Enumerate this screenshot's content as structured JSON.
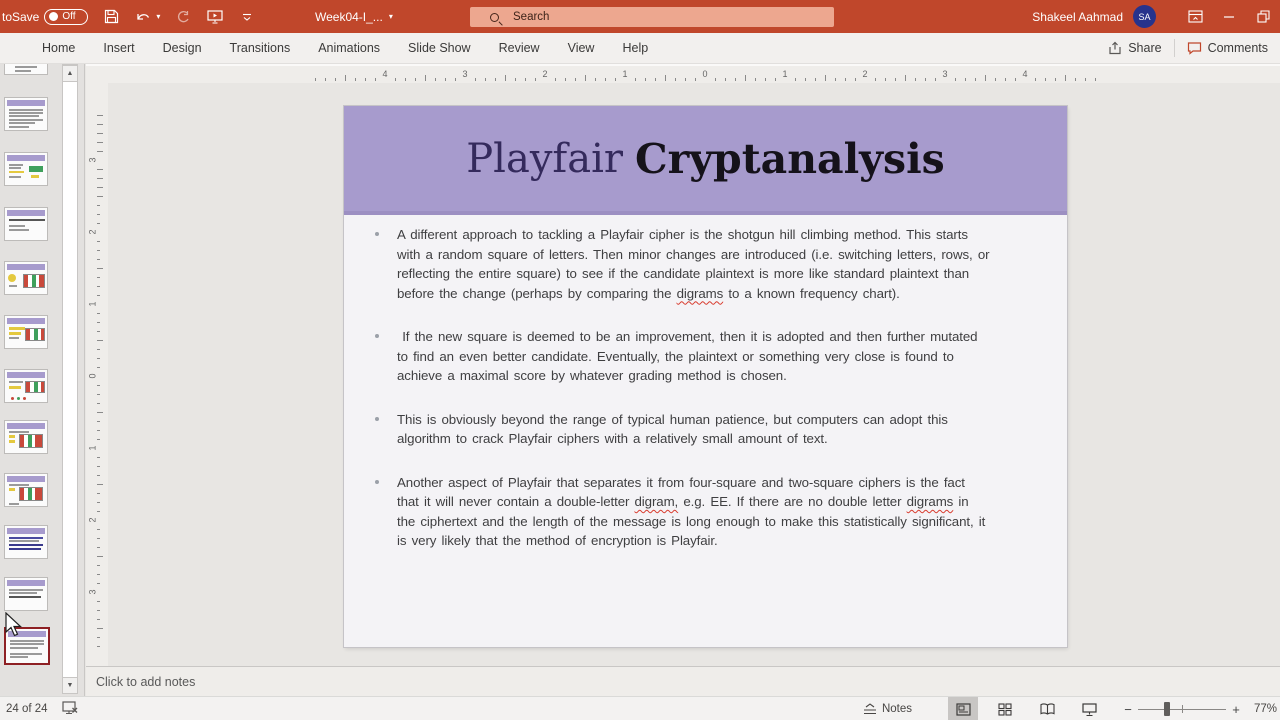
{
  "titlebar": {
    "autosave_label": "toSave",
    "autosave_state": "Off",
    "filename": "Week04-I_...",
    "search_placeholder": "Search",
    "user_name": "Shakeel Aahmad",
    "user_initials": "SA"
  },
  "ribbon": {
    "tabs": [
      "Home",
      "Insert",
      "Design",
      "Transitions",
      "Animations",
      "Slide Show",
      "Review",
      "View",
      "Help"
    ],
    "share_label": "Share",
    "comments_label": "Comments"
  },
  "rulers": {
    "horizontal": [
      "4",
      "3",
      "2",
      "1",
      "0",
      "1",
      "2",
      "3",
      "4"
    ],
    "vertical": [
      "3",
      "2",
      "1",
      "0",
      "1",
      "2",
      "3"
    ]
  },
  "slide": {
    "title_part1": "Playfair",
    "title_part2": "Cryptanalysis",
    "bullets": [
      {
        "segments": [
          {
            "t": "A different approach to tackling a Playfair cipher is the shotgun hill climbing method. This starts with a random square of letters. Then minor changes are introduced (i.e. switching letters, rows, or reflecting the entire square) to see if the candidate plaintext is more like standard plaintext than before the change (perhaps by comparing the "
          },
          {
            "t": "digrams",
            "misspelled": true
          },
          {
            "t": " to a known frequency chart)."
          }
        ]
      },
      {
        "segments": [
          {
            "t": " If the new square is deemed to be an improvement, then it is adopted and then further mutated to find an even better candidate. Eventually, the plaintext or something very close is found to achieve a maximal score by whatever grading method is chosen."
          }
        ]
      },
      {
        "segments": [
          {
            "t": "This is obviously beyond the range of typical human patience, but computers can adopt this algorithm to crack Playfair ciphers with a relatively small amount of text."
          }
        ]
      },
      {
        "segments": [
          {
            "t": "Another aspect of Playfair that separates it from four-square and two-square ciphers is the fact that it will never contain a double-letter "
          },
          {
            "t": "digram,",
            "misspelled": true
          },
          {
            "t": " e.g. EE. If there are no double letter "
          },
          {
            "t": "digrams",
            "misspelled": true
          },
          {
            "t": " in the ciphertext and the length of the message is long enough to make this statistically significant, it is very likely that the method of encryption is Playfair."
          }
        ]
      }
    ]
  },
  "notes": {
    "placeholder": "Click to add notes"
  },
  "statusbar": {
    "slide_counter": "24 of 24",
    "notes_label": "Notes",
    "zoom_level": "77%"
  },
  "colors": {
    "titlebar_red": "#C0472B",
    "search_pill": "#EDA78F",
    "avatar_blue": "#26338C",
    "slide_header_purple": "#A79BCD",
    "selected_thumb_border": "#8E2024",
    "misspell_red": "#D83B2E"
  }
}
